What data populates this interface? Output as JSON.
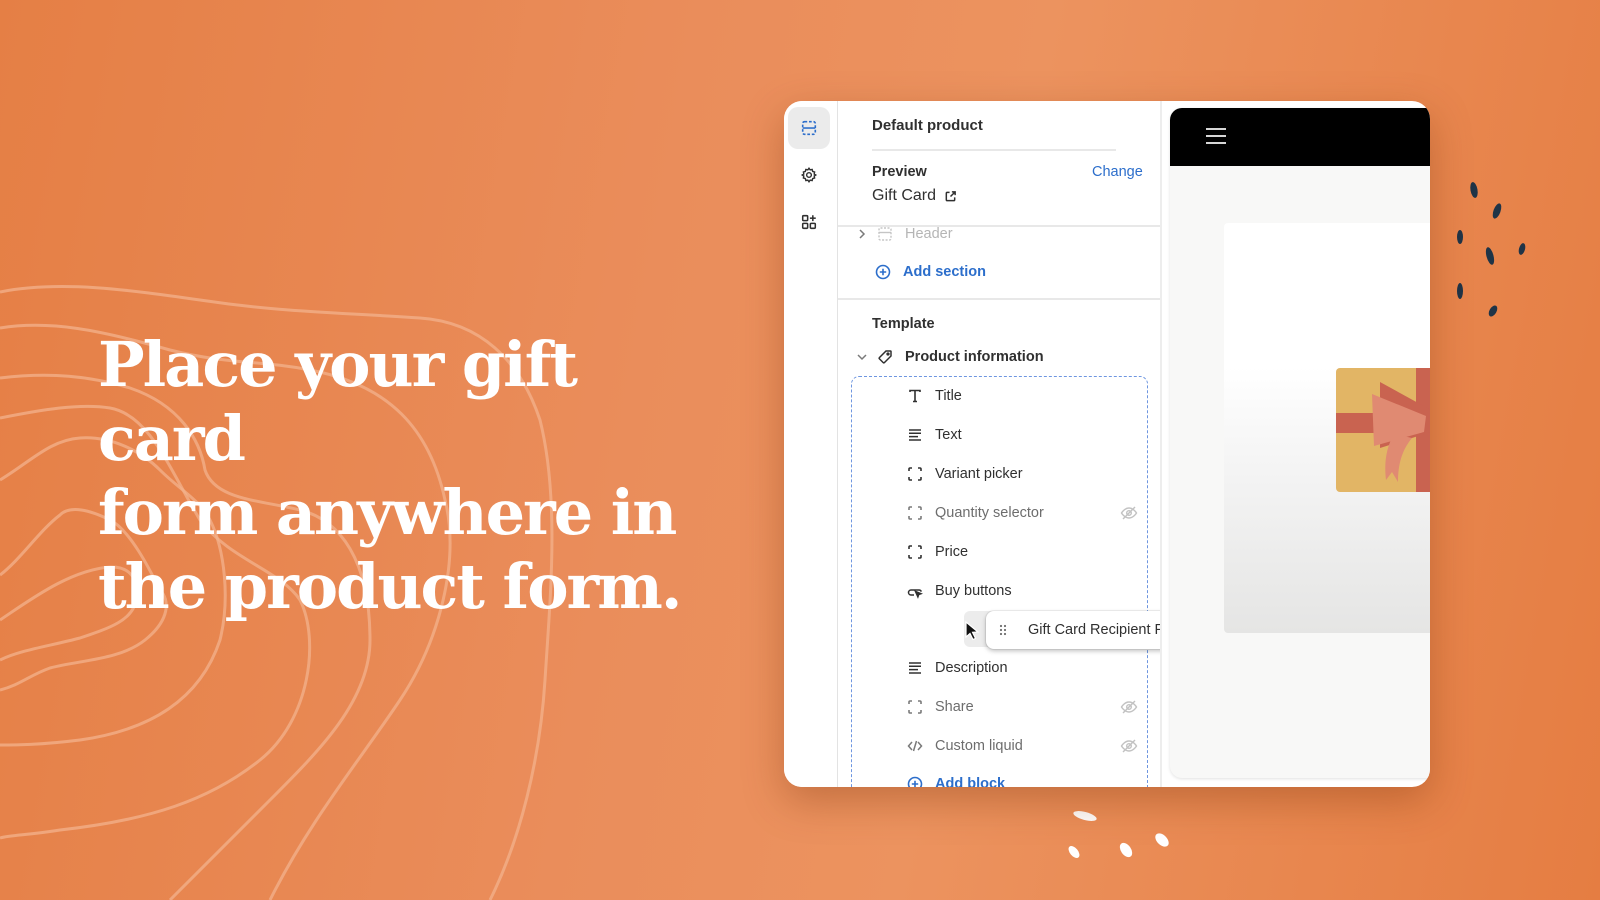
{
  "headline": {
    "lines": [
      "Place your gift card",
      "form anywhere in",
      "the product form."
    ]
  },
  "colors": {
    "background": "#e8864e",
    "accent_link": "#2c6ecb",
    "selection_dash": "#6e96e0",
    "text_primary": "#303030",
    "gift_box": "#e2b565",
    "ribbon": "#c96350"
  },
  "rail": {
    "items": [
      {
        "icon": "sections-icon",
        "active": true
      },
      {
        "icon": "gear-icon",
        "active": false
      },
      {
        "icon": "apps-add-icon",
        "active": false
      }
    ]
  },
  "panel": {
    "title": "Default product",
    "preview": {
      "label": "Preview",
      "change_label": "Change",
      "value": "Gift Card",
      "value_icon": "external-link-icon"
    },
    "header_section": {
      "label": "Header",
      "icon": "header-section-icon"
    },
    "add_section_label": "Add section",
    "template_label": "Template",
    "product_info": {
      "label": "Product information",
      "icon": "tag-icon"
    },
    "blocks": [
      {
        "label": "Title",
        "icon": "text-title-icon",
        "hidden": false
      },
      {
        "label": "Text",
        "icon": "text-align-icon",
        "hidden": false
      },
      {
        "label": "Variant picker",
        "icon": "block-frame-icon",
        "hidden": false
      },
      {
        "label": "Quantity selector",
        "icon": "block-frame-icon",
        "hidden": true
      },
      {
        "label": "Price",
        "icon": "block-frame-icon",
        "hidden": false
      },
      {
        "label": "Buy buttons",
        "icon": "cursor-button-icon",
        "hidden": false
      },
      {
        "label": "Description",
        "icon": "text-align-icon",
        "hidden": false
      },
      {
        "label": "Share",
        "icon": "block-frame-icon",
        "hidden": true
      },
      {
        "label": "Custom liquid",
        "icon": "code-icon",
        "hidden": true
      }
    ],
    "dragging_block": {
      "label": "Gift Card Recipient Form",
      "icon": "drag-handle-icon"
    },
    "add_block_label": "Add block"
  }
}
